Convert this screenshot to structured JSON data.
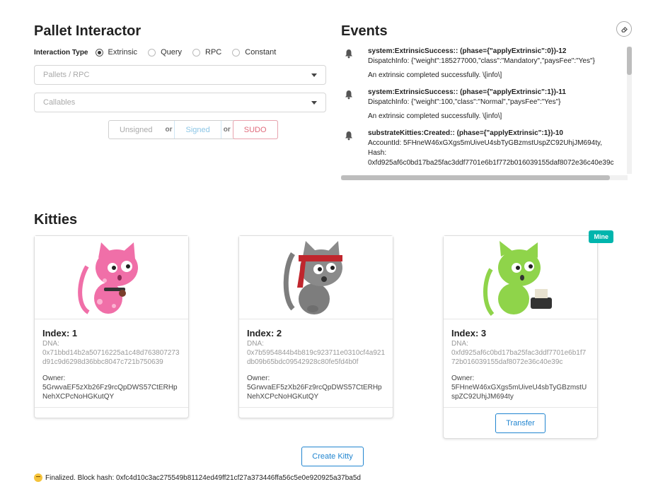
{
  "pallet": {
    "title": "Pallet Interactor",
    "interaction_type_label": "Interaction Type",
    "interaction_types": [
      "Extrinsic",
      "Query",
      "RPC",
      "Constant"
    ],
    "selected_type": "Extrinsic",
    "pallets_placeholder": "Pallets / RPC",
    "callables_placeholder": "Callables",
    "buttons": {
      "unsigned": "Unsigned",
      "or1": "or",
      "signed": "Signed",
      "or2": "or",
      "sudo": "SUDO"
    }
  },
  "events": {
    "title": "Events",
    "toggle_icon": "eraser-icon",
    "items": [
      {
        "title": "system:ExtrinsicSuccess:: (phase={\"applyExtrinsic\":0})-12",
        "detail": "DispatchInfo: {\"weight\":185277000,\"class\":\"Mandatory\",\"paysFee\":\"Yes\"}",
        "message": "An extrinsic completed successfully. \\[info\\]"
      },
      {
        "title": "system:ExtrinsicSuccess:: (phase={\"applyExtrinsic\":1})-11",
        "detail": "DispatchInfo: {\"weight\":100,\"class\":\"Normal\",\"paysFee\":\"Yes\"}",
        "message": "An extrinsic completed successfully. \\[info\\]"
      },
      {
        "title": "substrateKitties:Created:: (phase={\"applyExtrinsic\":1})-10",
        "detail": "AccountId: 5FHneW46xGXgs5mUiveU4sbTyGBzmstUspZC92UhjJM694ty,",
        "detail2": "Hash:",
        "detail3": "0xfd925af6c0bd17ba25fac3ddf7701e6b1f772b016039155daf8072e36c40e39c"
      }
    ]
  },
  "kitties": {
    "title": "Kitties",
    "dna_label": "DNA:",
    "owner_label": "Owner:",
    "cards": [
      {
        "index": "Index: 1",
        "dna": "0x71bbd14b2a50716225a1c48d763807273d91c9d6298d36bbc8047c721b750639",
        "owner": "5GrwvaEF5zXb26Fz9rcQpDWS57CtERHpNehXCPcNoHGKutQY",
        "color": "#f06fa8"
      },
      {
        "index": "Index: 2",
        "dna": "0x7b5954844b4b819c923711e0310cf4a921db09b65bdc09542928c80fe5fd4b0f",
        "owner": "5GrwvaEF5zXb26Fz9rcQpDWS57CtERHpNehXCPcNoHGKutQY",
        "color": "#7d7d7d"
      },
      {
        "index": "Index: 3",
        "dna": "0xfd925af6c0bd17ba25fac3ddf7701e6b1f772b016039155daf8072e36c40e39c",
        "owner": "5FHneW46xGXgs5mUiveU4sbTyGBzmstUspZC92UhjJM694ty",
        "color": "#8fd44a",
        "badge": "Mine",
        "action": "Transfer"
      }
    ],
    "create_label": "Create Kitty"
  },
  "footer": {
    "status": "Finalized. Block hash: 0xfc4d10c3ac275549b81124ed49ff21cf27a373446ffa56c5e0e920925a37ba5d"
  },
  "colors": {
    "accent": "#2185d0",
    "teal": "#00b5ad",
    "sudo": "#e06b7c",
    "signed": "#8cc6e6"
  }
}
